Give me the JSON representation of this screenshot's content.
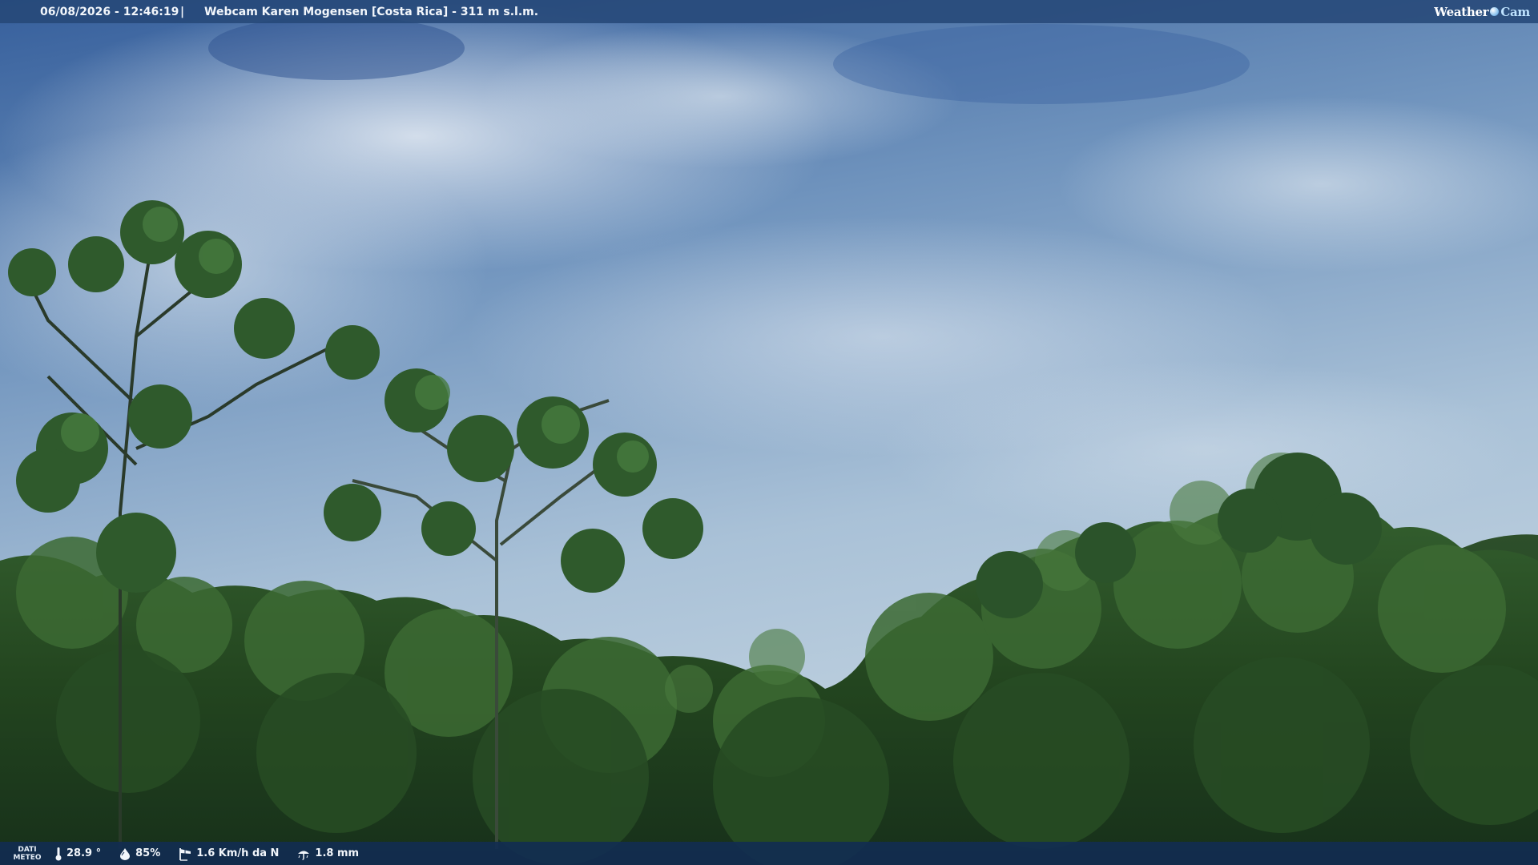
{
  "overlay": {
    "datetime": "06/08/2026 - 12:46:19",
    "separator": "|",
    "title": "Webcam Karen Mogensen [Costa Rica]  - 311 m s.l.m.",
    "logo_weather": "Weather",
    "logo_cam": "Cam"
  },
  "meteo": {
    "label_line1": "DATI",
    "label_line2": "METEO",
    "temperature": "28.9 °",
    "humidity": "85%",
    "wind": "1.6 Km/h da N",
    "rain": "1.8 mm"
  },
  "icons": {
    "temperature": "thermometer-icon",
    "humidity": "droplet-icon",
    "wind": "windsock-icon",
    "rain": "rain-icon"
  },
  "colors": {
    "topbar": "#264878",
    "bottombar": "#122c52",
    "sky_top": "#3f6aa6",
    "sky_bottom": "#b8cedf",
    "foliage_dark": "#1c3a1c",
    "foliage_light": "#3f6d34"
  }
}
